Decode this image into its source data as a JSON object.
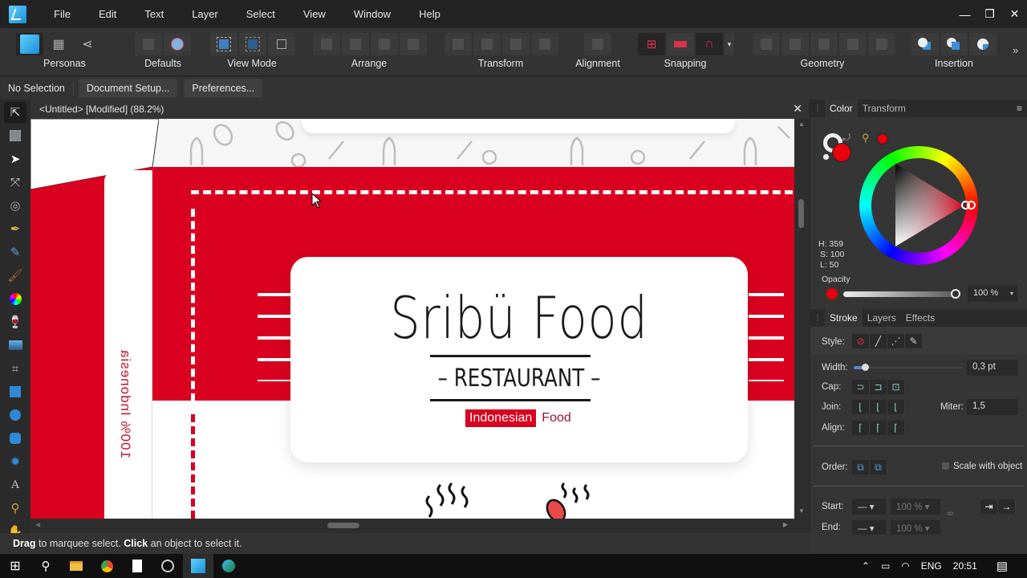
{
  "app": {
    "menu": [
      "File",
      "Edit",
      "Text",
      "Layer",
      "Select",
      "View",
      "Window",
      "Help"
    ],
    "window_controls": {
      "minimize": "—",
      "restore": "❐",
      "close": "✕"
    }
  },
  "toolbar": {
    "groups": [
      {
        "label": "Personas"
      },
      {
        "label": "Defaults"
      },
      {
        "label": "View Mode"
      },
      {
        "label": "Arrange"
      },
      {
        "label": "Transform"
      },
      {
        "label": "Alignment"
      },
      {
        "label": "Snapping"
      },
      {
        "label": "Geometry"
      },
      {
        "label": "Insertion"
      }
    ],
    "overflow": "»"
  },
  "context": {
    "selection": "No Selection",
    "document_setup": "Document Setup...",
    "preferences": "Preferences..."
  },
  "tools": [
    "move-tool",
    "artboard-tool",
    "node-tool",
    "corner-tool",
    "point-transform-tool",
    "pen-tool",
    "pencil-tool",
    "vector-brush-tool",
    "fill-tool",
    "transparency-tool",
    "place-image-tool",
    "crop-tool",
    "rectangle-tool",
    "ellipse-tool",
    "rounded-rectangle-tool",
    "shape-tool",
    "text-tool",
    "color-picker-tool",
    "view-tool"
  ],
  "document": {
    "tab_title": "<Untitled> [Modified] (88.2%)",
    "close": "✕"
  },
  "artwork": {
    "brand_title": "Sribü Food",
    "subtitle": "RESTAURANT",
    "tag_highlight": "Indonesian",
    "tag_rest": "Food",
    "side_text": "100% Indonesia",
    "brand_red": "#d90020"
  },
  "status": {
    "drag": "Drag",
    "drag_rest": " to marquee select. ",
    "click": "Click",
    "click_rest": " an object to select it."
  },
  "color_panel": {
    "tabs": [
      "Color",
      "Transform"
    ],
    "active_tab": "Color",
    "h": "H: 359",
    "s": "S: 100",
    "l": "L: 50",
    "opacity_label": "Opacity",
    "opacity_value": "100 %",
    "opacity_fraction": 1.0,
    "current_color": "#e8000b"
  },
  "stroke_panel": {
    "tabs": [
      "Stroke",
      "Layers",
      "Effects"
    ],
    "active_tab": "Stroke",
    "style_label": "Style:",
    "width_label": "Width:",
    "width_value": "0,3 pt",
    "cap_label": "Cap:",
    "join_label": "Join:",
    "miter_label": "Miter:",
    "miter_value": "1,5",
    "align_label": "Align:",
    "order_label": "Order:",
    "scale_with_object": "Scale with object",
    "start_label": "Start:",
    "start_pct": "100 %",
    "end_label": "End:",
    "end_pct": "100 %"
  },
  "taskbar": {
    "lang": "ENG",
    "time": "20:51"
  }
}
